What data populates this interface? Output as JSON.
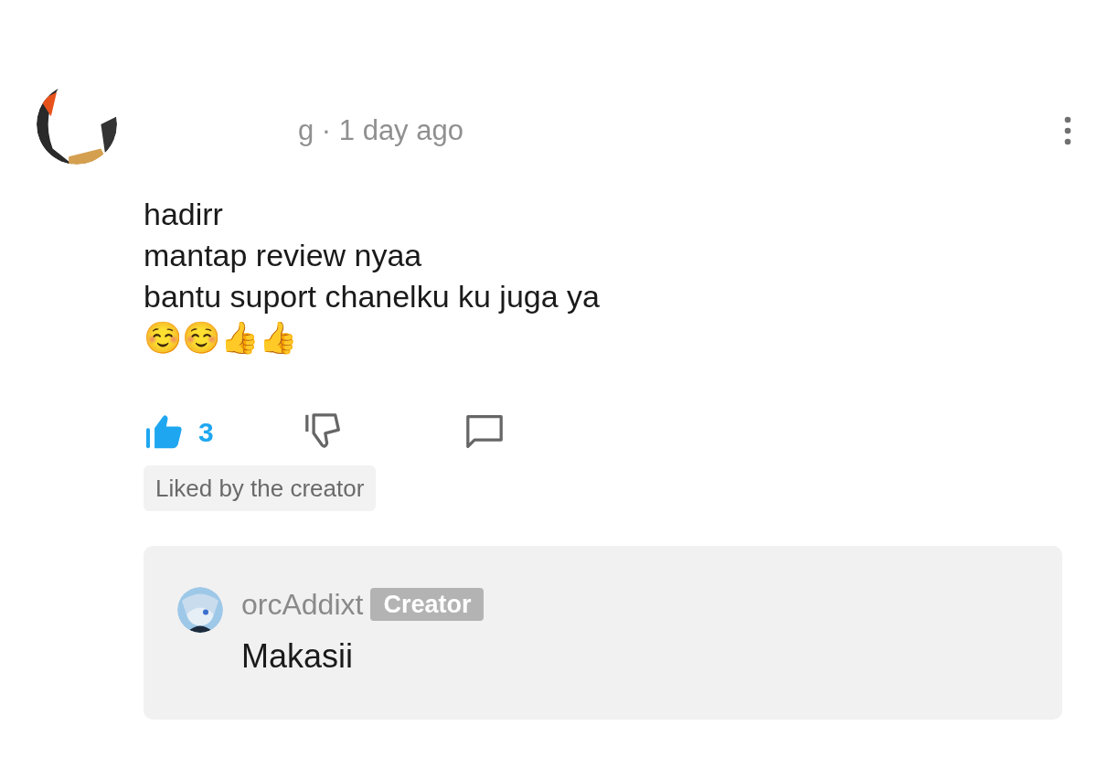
{
  "comment": {
    "meta": "g · 1 day ago",
    "lines": [
      "hadirr",
      "mantap review nyaa",
      "bantu suport chanelku ku juga ya",
      "☺️☺️👍👍"
    ],
    "likes": "3",
    "liked": true,
    "badge": "Liked by the creator"
  },
  "reply": {
    "author": "orcAddixt",
    "author_badge": "Creator",
    "text": "Makasii"
  }
}
